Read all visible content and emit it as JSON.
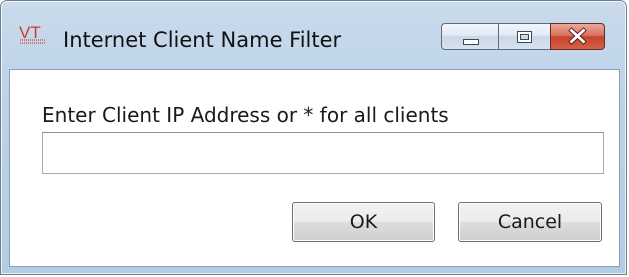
{
  "window": {
    "title": "Internet Client Name Filter",
    "logo_text": "VT"
  },
  "dialog": {
    "prompt_label": "Enter Client IP Address or * for all clients",
    "ip_field": {
      "value": "",
      "placeholder": ""
    },
    "ok_label": "OK",
    "cancel_label": "Cancel"
  },
  "icons": {
    "app": "vt-logo-icon",
    "minimize": "minimize-icon",
    "maximize": "maximize-icon",
    "close": "close-icon"
  },
  "colors": {
    "title_bar": "#bcd2e8",
    "close_button": "#c4452c",
    "logo_red": "#d23a2a"
  }
}
